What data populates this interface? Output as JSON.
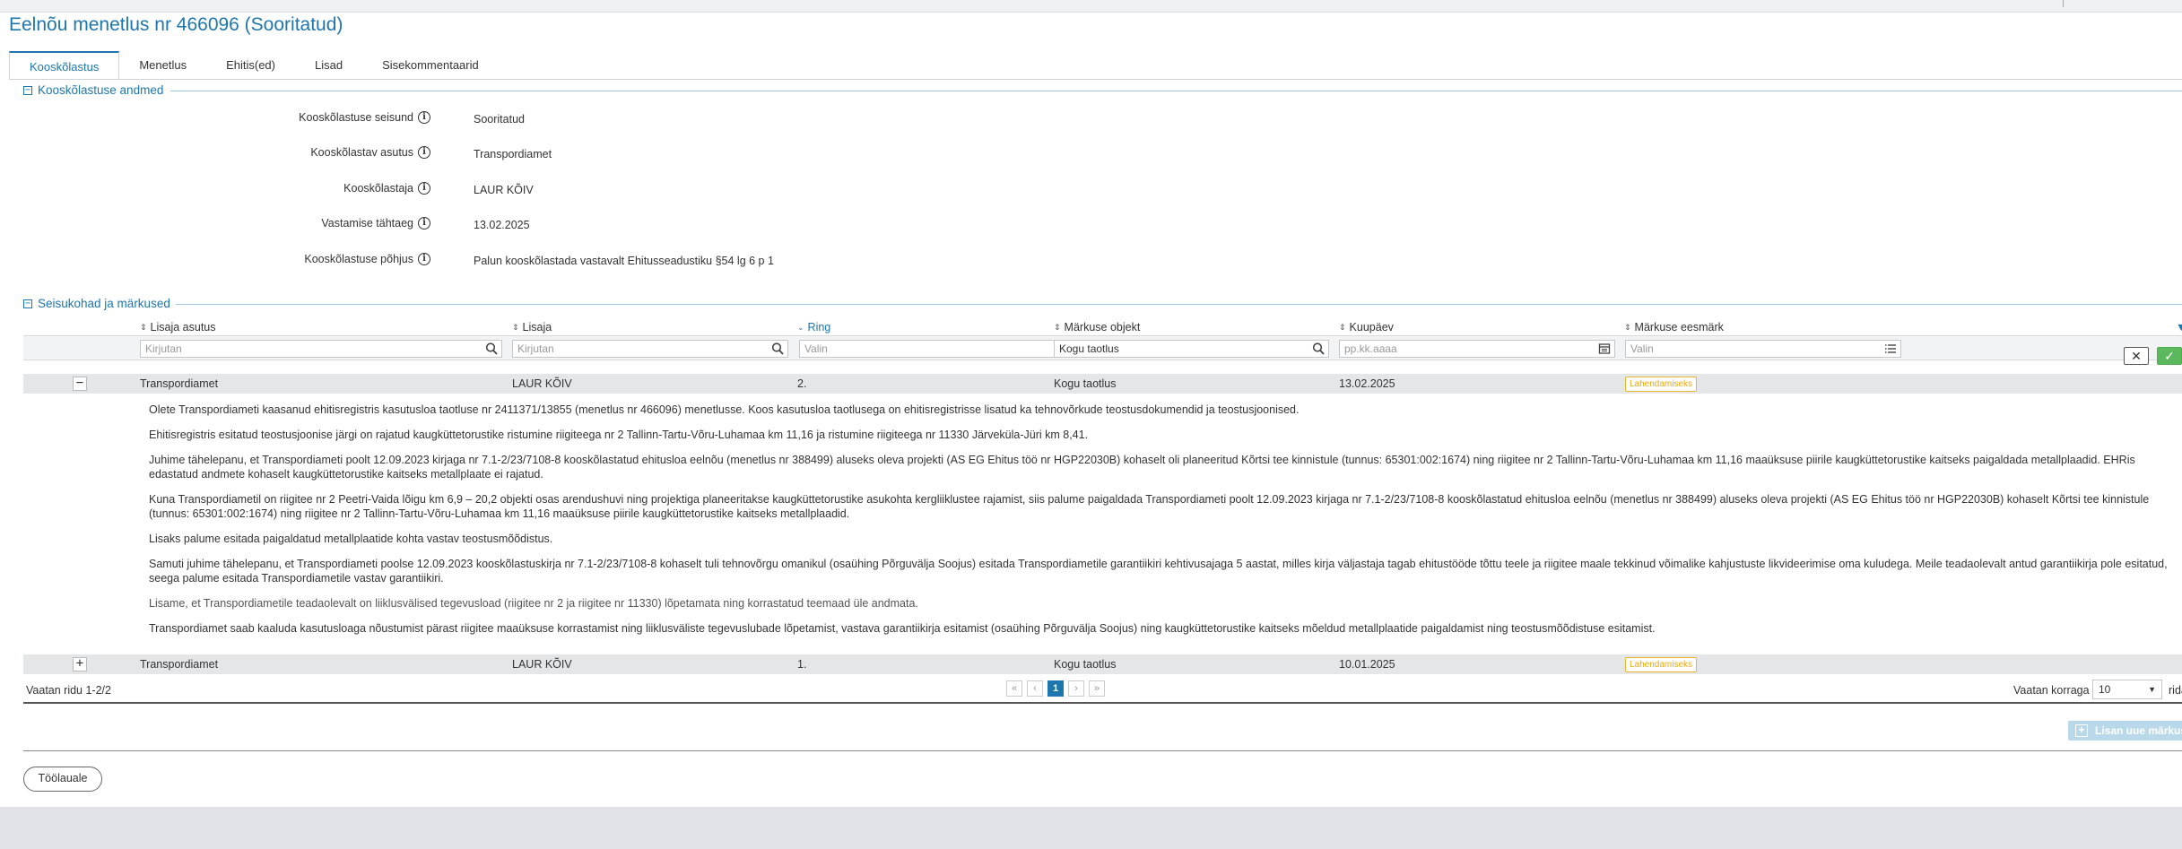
{
  "page": {
    "title": "Eelnõu menetlus nr 466096 (Sooritatud)"
  },
  "tabs": [
    {
      "label": "Kooskõlastus"
    },
    {
      "label": "Menetlus"
    },
    {
      "label": "Ehitis(ed)"
    },
    {
      "label": "Lisad"
    },
    {
      "label": "Sisekommentaarid"
    }
  ],
  "sections": {
    "details": {
      "label": "Kooskõlastuse andmed"
    },
    "remarks": {
      "label": "Seisukohad ja märkused"
    }
  },
  "fields": [
    {
      "label": "Kooskõlastuse seisund",
      "value": "Sooritatud"
    },
    {
      "label": "Kooskõlastav asutus",
      "value": "Transpordiamet"
    },
    {
      "label": "Kooskõlastaja",
      "value": "LAUR KÕIV"
    },
    {
      "label": "Vastamise tähtaeg",
      "value": "13.02.2025"
    },
    {
      "label": "Kooskõlastuse põhjus",
      "value": "Palun kooskõlastada vastavalt Ehitusseadustiku §54 lg 6 p 1"
    }
  ],
  "columns": [
    {
      "label": "Lisaja asutus"
    },
    {
      "label": "Lisaja"
    },
    {
      "label": "Ring"
    },
    {
      "label": "Märkuse objekt"
    },
    {
      "label": "Kuupäev"
    },
    {
      "label": "Märkuse eesmärk"
    }
  ],
  "filters": [
    {
      "placeholder": "Kirjutan"
    },
    {
      "placeholder": "Kirjutan"
    },
    {
      "placeholder": "Valin"
    },
    {
      "placeholder": "Kogu taotlus"
    },
    {
      "placeholder": "pp.kk.aaaa"
    },
    {
      "placeholder": "Valin"
    }
  ],
  "rows": [
    {
      "toggle": "−",
      "agency": "Transpordiamet",
      "author": "LAUR KÕIV",
      "round": "2.",
      "object": "Kogu taotlus",
      "date": "13.02.2025",
      "purpose": "Lahendamiseks",
      "paragraphs": [
        "Olete Transpordiameti kaasanud ehitisregistris kasutusloa taotluse nr 2411371/13855 (menetlus nr 466096) menetlusse. Koos kasutusloa taotlusega on ehitisregistrisse lisatud ka tehnovõrkude teostusdokumendid ja teostusjoonised.",
        "Ehitisregistris esitatud teostusjoonise järgi on rajatud kaugküttetorustike ristumine riigiteega nr 2 Tallinn-Tartu-Võru-Luhamaa km 11,16 ja ristumine riigiteega nr 11330 Järveküla-Jüri km 8,41.",
        "Juhime tähelepanu, et Transpordiameti poolt 12.09.2023 kirjaga nr 7.1-2/23/7108-8 kooskõlastatud ehitusloa eelnõu (menetlus nr 388499) aluseks oleva projekti (AS EG Ehitus töö nr HGP22030B) kohaselt oli planeeritud Kõrtsi tee kinnistule (tunnus: 65301:002:1674) ning riigitee nr 2 Tallinn-Tartu-Võru-Luhamaa km 11,16 maaüksuse piirile kaugküttetorustike kaitseks paigaldada metallplaadid. EHRis edastatud andmete kohaselt kaugküttetorustike kaitseks metallplaate ei rajatud.",
        "Kuna Transpordiametil on riigitee nr 2 Peetri-Vaida lõigu km 6,9 – 20,2 objekti osas arendushuvi ning projektiga planeeritakse kaugküttetorustike asukohta kergliiklustee rajamist, siis palume paigaldada Transpordiameti poolt 12.09.2023 kirjaga nr 7.1-2/23/7108-8 kooskõlastatud ehitusloa eelnõu (menetlus nr 388499) aluseks oleva projekti (AS EG Ehitus töö nr HGP22030B) kohaselt Kõrtsi tee kinnistule (tunnus: 65301:002:1674) ning riigitee nr 2 Tallinn-Tartu-Võru-Luhamaa km 11,16 maaüksuse piirile kaugküttetorustike kaitseks metallplaadid.",
        "Lisaks palume esitada paigaldatud metallplaatide kohta vastav teostusmõõdistus.",
        "Samuti juhime tähelepanu, et Transpordiameti poolse 12.09.2023 kooskõlastuskirja nr 7.1-2/23/7108-8 kohaselt tuli tehnovõrgu omanikul (osaühing Põrguvälja Soojus) esitada Transpordiametile garantiikiri kehtivusajaga 5 aastat, milles kirja väljastaja tagab ehitustööde tõttu teele ja riigitee maale tekkinud võimalike kahjustuste likvideerimise oma kuludega. Meile teadaolevalt antud garantiikirja pole esitatud, seega palume esitada Transpordiametile vastav garantiikiri.",
        "Lisame, et Transpordiametile teadaolevalt on liiklusvälised tegevusload (riigitee nr 2 ja riigitee nr 11330) lõpetamata ning korrastatud teemaad üle andmata.",
        "Transpordiamet saab kaaluda kasutusloaga nõustumist pärast riigitee maaüksuse korrastamist ning liiklusväliste tegevuslubade lõpetamist, vastava garantiikirja esitamist (osaühing Põrguvälja Soojus) ning kaugküttetorustike kaitseks mõeldud metallplaatide paigaldamist ning teostusmõõdistuse esitamist."
      ]
    },
    {
      "toggle": "+",
      "agency": "Transpordiamet",
      "author": "LAUR KÕIV",
      "round": "1.",
      "object": "Kogu taotlus",
      "date": "10.01.2025",
      "purpose": "Lahendamiseks"
    }
  ],
  "pagination": {
    "info": "Vaatan ridu 1-2/2",
    "first": "«",
    "prev": "‹",
    "current": "1",
    "next": "›",
    "last": "»",
    "per_page_label": "Vaatan korraga",
    "per_page_value": "10",
    "rows_label": "rida"
  },
  "buttons": {
    "add_remark": "Lisan uue märkuse",
    "back": "Töölauale",
    "clear": "✕",
    "apply": "✓"
  },
  "colors": {
    "accent": "#1d76ad",
    "badge": "#e8a90c",
    "apply": "#5cb85c"
  }
}
